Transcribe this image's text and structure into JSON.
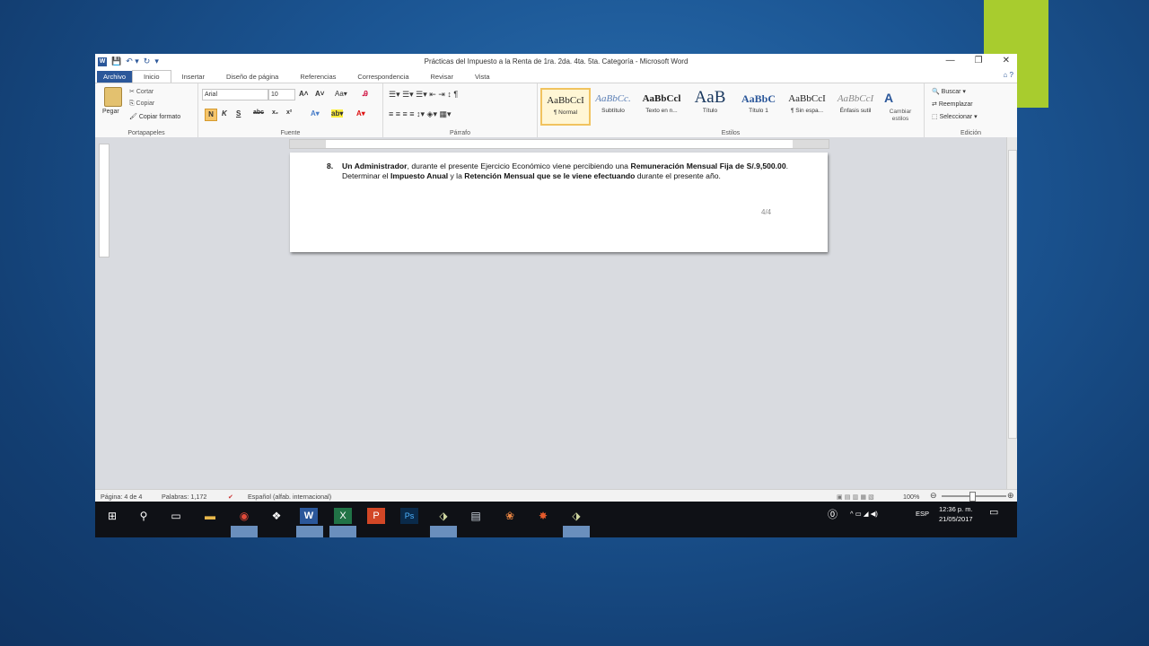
{
  "window": {
    "title": "Prácticas del Impuesto a la Renta de 1ra. 2da. 4ta. 5ta. Categoría - Microsoft Word",
    "minimize": "—",
    "restore": "❐",
    "close": "✕"
  },
  "qat": {
    "app_icon": "W",
    "save": "💾",
    "undo": "↶ ▾",
    "redo": "↻",
    "customize": "▾"
  },
  "tabs": [
    "Archivo",
    "Inicio",
    "Insertar",
    "Diseño de página",
    "Referencias",
    "Correspondencia",
    "Revisar",
    "Vista"
  ],
  "tabs_right": "⌂ ?",
  "ribbon": {
    "clipboard": {
      "paste": "Pegar",
      "cut": "Cortar",
      "copy": "Copiar",
      "format_painter": "Copiar formato",
      "group": "Portapapeles"
    },
    "font": {
      "family": "Arial",
      "size": "10",
      "group": "Fuente",
      "grow": "A˄",
      "shrink": "A˅",
      "case": "Aa▾",
      "clear": "Ꭿ",
      "bold": "N",
      "italic": "K",
      "underline": "S",
      "strike": "abc",
      "sub": "x₂",
      "sup": "x²",
      "effects": "A▾",
      "highlight": "ab▾",
      "color": "A▾"
    },
    "paragraph": {
      "group": "Párrafo",
      "row1": "☰▾  ☰▾  ☰▾   ⇤ ⇥   ↕   ¶",
      "row2": "≡  ≡  ≡  ≡   ↕▾   ◈▾  ▦▾"
    },
    "styles": {
      "group": "Estilos",
      "items": [
        {
          "sample": "AaBbCcI",
          "name": "¶ Normal"
        },
        {
          "sample": "AaBbCc.",
          "name": "Subtítulo"
        },
        {
          "sample": "AaBbCcl",
          "name": "Texto en n..."
        },
        {
          "sample": "AaB",
          "name": "Título"
        },
        {
          "sample": "AaBbC",
          "name": "Título 1"
        },
        {
          "sample": "AaBbCcI",
          "name": "¶ Sin espa..."
        },
        {
          "sample": "AaBbCcI",
          "name": "Énfasis sutil"
        }
      ],
      "change": "Cambiar estilos"
    },
    "editing": {
      "group": "Edición",
      "find": "Buscar",
      "replace": "Reemplazar",
      "select": "Seleccionar"
    }
  },
  "document": {
    "item_number": "8.",
    "text_runs": [
      {
        "t": "Un Administrador",
        "b": true
      },
      {
        "t": ", durante el presente Ejercicio Económico viene percibiendo una ",
        "b": false
      },
      {
        "t": "Remuneración Mensual Fija de S/.9,500.00",
        "b": true
      },
      {
        "t": ". Determinar el ",
        "b": false
      },
      {
        "t": "Impuesto Anual",
        "b": true
      },
      {
        "t": " y la ",
        "b": false
      },
      {
        "t": "Retención Mensual que se le viene efectuando",
        "b": true
      },
      {
        "t": " durante el presente año.",
        "b": false
      }
    ],
    "page_marker": "4/4"
  },
  "status": {
    "page": "Página: 4 de 4",
    "words": "Palabras: 1,172",
    "language": "Español (alfab. internacional)",
    "zoom": "100%",
    "zoom_level": 0.5
  },
  "taskbar": {
    "lang": "ESP",
    "time": "12:36 p. m.",
    "date": "21/05/2017"
  }
}
